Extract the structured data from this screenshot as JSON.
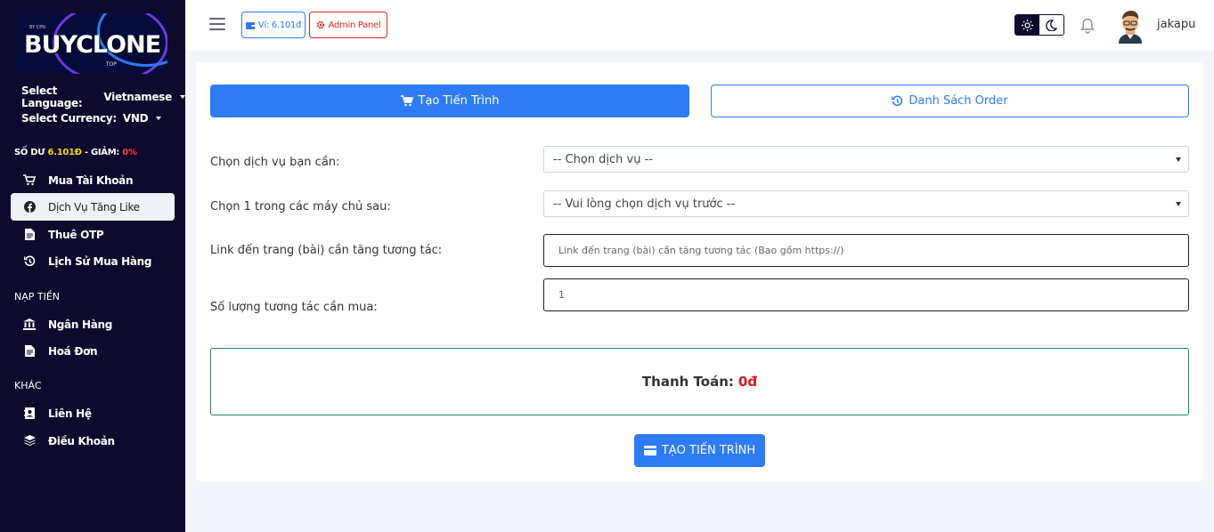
{
  "logo": {
    "by": "BY CPN",
    "brand": "BUYCLONE",
    "suffix": ".TOP"
  },
  "sidebar": {
    "language_label": "Select Language:",
    "language_value": "Vietnamese",
    "currency_label": "Select Currency:",
    "currency_value": "VND",
    "balance_label": "SỐ DƯ",
    "balance_value": "6.101Đ",
    "discount_sep": " - GIẢM:",
    "discount_value": "0%",
    "items": [
      {
        "label": "Mua Tài Khoản",
        "icon": "cart-icon"
      },
      {
        "label": "Dịch Vụ Tăng Like",
        "icon": "facebook-icon",
        "active": true
      },
      {
        "label": "Thuê OTP",
        "icon": "document-icon"
      },
      {
        "label": "Lịch Sử Mua Hàng",
        "icon": "history-icon"
      }
    ],
    "section_nap": "NẠP TIỀN",
    "nap_items": [
      {
        "label": "Ngân Hàng",
        "icon": "bank-icon"
      },
      {
        "label": "Hoá Đơn",
        "icon": "invoice-icon"
      }
    ],
    "section_khac": "KHÁC",
    "khac_items": [
      {
        "label": "Liên Hệ",
        "icon": "contact-icon"
      },
      {
        "label": "Điều Khoản",
        "icon": "layers-icon"
      }
    ]
  },
  "topbar": {
    "wallet_label": "Ví: 6.101đ",
    "admin_label": "Admin Panel",
    "username": "jakapu"
  },
  "main": {
    "tab_create": "Tạo Tiến Trình",
    "tab_orders": "Danh Sách Order",
    "service_label": "Chọn dịch vụ bạn cần:",
    "service_value": "-- Chọn dịch vụ --",
    "server_label": "Chọn 1 trong các máy chủ sau:",
    "server_value": "-- Vui lòng chọn dịch vụ trước --",
    "link_label": "Link đến trang (bài) cần tăng tương tác:",
    "link_placeholder": "Link đến trang (bài) cần tăng tương tác (Bao gồm https://)",
    "quantity_label": "Số lượng tương tác cần mua:",
    "quantity_value": "1",
    "payment_label": "Thanh Toán:",
    "payment_amount": "0đ",
    "submit_label": "TẠO TIẾN TRÌNH"
  },
  "colors": {
    "sidebar_bg": "#0e0a2d",
    "primary": "#2e7bf6",
    "danger": "#e02424",
    "balance_yellow": "#ffd400"
  }
}
